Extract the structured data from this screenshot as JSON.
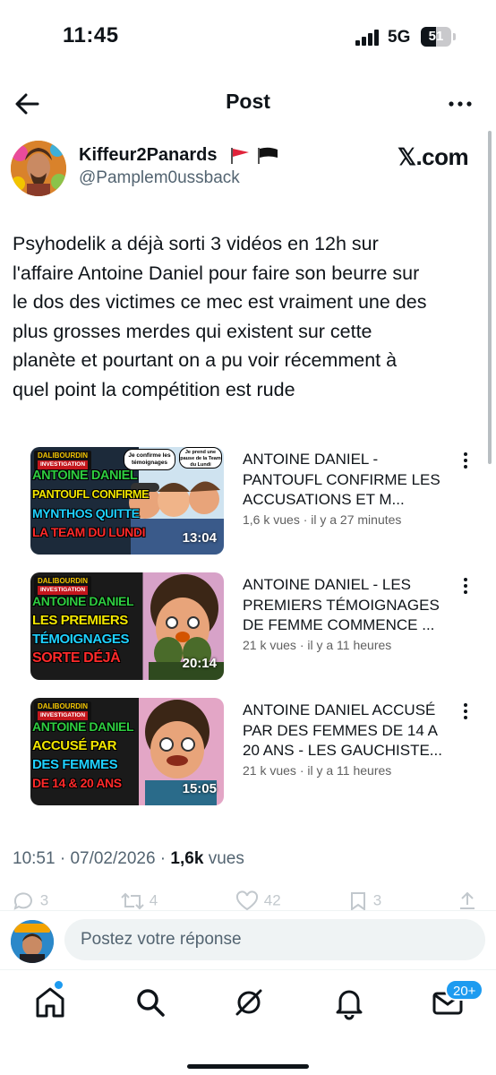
{
  "status_bar": {
    "time": "11:45",
    "network": "5G",
    "battery": "51",
    "battery_level": 0.51
  },
  "header": {
    "title": "Post"
  },
  "author": {
    "name": "Kiffeur2Panards",
    "handle": "@Pamplem0ussback",
    "source": "𝕏.com"
  },
  "tweet": {
    "text": "Psyhodelik a déjà sorti 3 vidéos en 12h sur\nl'affaire Antoine Daniel pour faire son beurre sur\nle dos des victimes ce mec est vraiment une des\nplus grosses merdes qui existent sur cette\nplanète et pourtant on a pu voir récemment à\nquel point la compétition est rude"
  },
  "videos": [
    {
      "title": "ANTOINE DANIEL - PANTOUFL CONFIRME LES ACCUSATIONS ET M...",
      "meta": "1,6 k vues · il y a 27 minutes",
      "duration": "13:04",
      "thumb_lines": [
        "ANTOINE DANIEL",
        "PANTOUFL CONFIRME",
        "MYNTHOS QUITTE",
        "LA TEAM DU LUNDI"
      ],
      "bubble_1": "Je confirme les témoignages",
      "bubble_2": "Je prend une pause de la Team du Lundi"
    },
    {
      "title": "ANTOINE DANIEL - LES PREMIERS TÉMOIGNAGES DE FEMME COMMENCE ...",
      "meta": "21 k vues · il y a 11 heures",
      "duration": "20:14",
      "thumb_lines": [
        "ANTOINE DANIEL",
        "LES PREMIERS",
        "TÉMOIGNAGES",
        "SORTE DÉJÀ"
      ]
    },
    {
      "title": "ANTOINE DANIEL ACCUSÉ PAR DES FEMMES DE 14 A 20 ANS - LES GAUCHISTE...",
      "meta": "21 k vues · il y a 11 heures",
      "duration": "15:05",
      "thumb_lines": [
        "ANTOINE DANIEL",
        "ACCUSÉ PAR",
        "DES FEMMES",
        "DE 14 & 20 ANS"
      ]
    }
  ],
  "thumb_brand": {
    "top": "DALIBOURDIN",
    "bottom": "INVESTIGATION"
  },
  "post_meta": {
    "time": "10:51",
    "date": "07/02/2026",
    "views_count": "1,6k",
    "views_label": "vues"
  },
  "actions": {
    "replies": "3",
    "reposts": "4",
    "likes": "42",
    "bookmarks": "3"
  },
  "reply": {
    "placeholder": "Postez votre réponse"
  },
  "tab_bar": {
    "notifications_badge": "20+"
  },
  "colors": {
    "accent": "#1d9bf0",
    "text": "#0f1419",
    "secondary": "#536471"
  }
}
